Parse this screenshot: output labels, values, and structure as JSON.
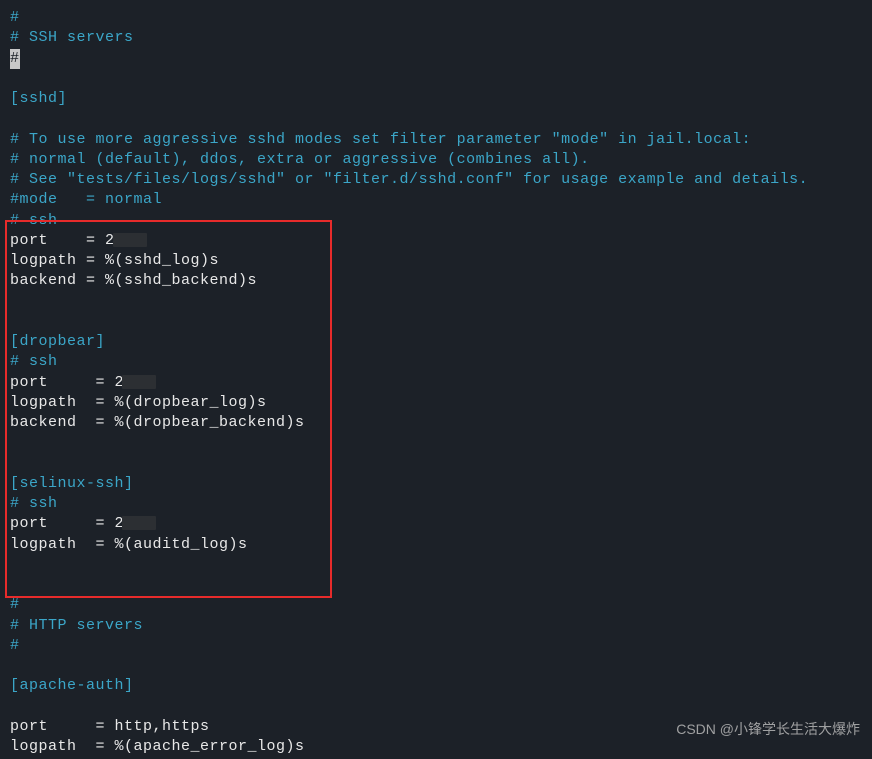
{
  "lines": {
    "l1": "#",
    "l2": "# SSH servers",
    "l3_cursor": "#",
    "l4": "",
    "l5": "[sshd]",
    "l6": "",
    "l7": "# To use more aggressive sshd modes set filter parameter \"mode\" in jail.local:",
    "l8": "# normal (default), ddos, extra or aggressive (combines all).",
    "l9": "# See \"tests/files/logs/sshd\" or \"filter.d/sshd.conf\" for usage example and details.",
    "l10": "#mode   = normal",
    "l11": "# ssh",
    "l12_a": "port    = 2",
    "l13": "logpath = %(sshd_log)s",
    "l14": "backend = %(sshd_backend)s",
    "l15": "",
    "l16": "",
    "l17": "[dropbear]",
    "l18": "# ssh",
    "l19_a": "port     = 2",
    "l20": "logpath  = %(dropbear_log)s",
    "l21": "backend  = %(dropbear_backend)s",
    "l22": "",
    "l23": "",
    "l24": "[selinux-ssh]",
    "l25": "# ssh",
    "l26_a": "port     = 2",
    "l27": "logpath  = %(auditd_log)s",
    "l28": "",
    "l29": "",
    "l30": "#",
    "l31": "# HTTP servers",
    "l32": "#",
    "l33": "",
    "l34": "[apache-auth]",
    "l35": "",
    "l36": "port     = http,https",
    "l37": "logpath  = %(apache_error_log)s"
  },
  "watermark": "CSDN @小锋学长生活大爆炸"
}
